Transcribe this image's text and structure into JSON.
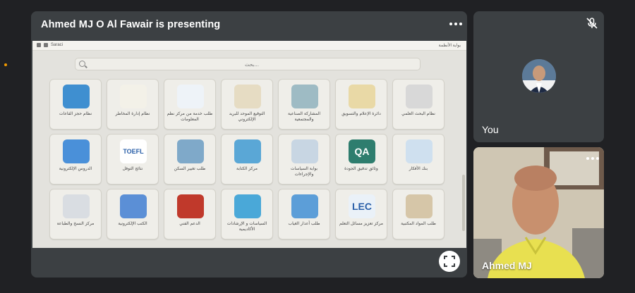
{
  "presentation": {
    "title": "Ahmed MJ O Al Fawair is presenting",
    "more_icon": "more-vert-icon",
    "fullscreen_icon": "fullscreen-icon"
  },
  "portal": {
    "topbar_left": "Saraci",
    "topbar_right": "بوابة الأنظمة",
    "search_placeholder": "بحث...",
    "tiles": [
      {
        "label": "نظام حجز القاعات",
        "icon": "calendar-icon",
        "color": "#3f8fd0"
      },
      {
        "label": "نظام إدارة المخاطر",
        "icon": "leaf-icon",
        "color": "#f3f1e8"
      },
      {
        "label": "طلب خدمة من مركز نظم المعلومات",
        "icon": "document-icon",
        "color": "#eef3f8"
      },
      {
        "label": "التوقيع الموحد للبريد الإلكتروني",
        "icon": "signature-icon",
        "color": "#e6dcc3"
      },
      {
        "label": "المشاركة الصناعية والمجتمعية",
        "icon": "factory-icon",
        "color": "#9ebbc4"
      },
      {
        "label": "دائرة الإعلام والتسويق",
        "icon": "media-icon",
        "color": "#e9d9a6"
      },
      {
        "label": "نظام البحث العلمي",
        "icon": "research-icon",
        "color": "#d8d8d8"
      },
      {
        "label": "الدروس الإلكترونية",
        "icon": "clapperboard-icon",
        "color": "#4a90d9"
      },
      {
        "label": "نتائج التوفل",
        "icon": "toefl-icon",
        "color": "#ffffff",
        "text": "TOEFL"
      },
      {
        "label": "طلب تغيير السكن",
        "icon": "building-icon",
        "color": "#7fa9c9"
      },
      {
        "label": "مركز الكتابة",
        "icon": "pen-icon",
        "color": "#5aa7d6"
      },
      {
        "label": "بوابة السياسات والإجراءات",
        "icon": "books-icon",
        "color": "#c8d6e3"
      },
      {
        "label": "وثائق تدقيق الجودة",
        "icon": "qa-icon",
        "color": "#2e7d6e",
        "text": "QA"
      },
      {
        "label": "بنك الأفكار",
        "icon": "ideas-icon",
        "color": "#cfe0ef"
      },
      {
        "label": "مركز النسخ والطباعة",
        "icon": "printer-icon",
        "color": "#d9dde2"
      },
      {
        "label": "الكتب الإلكترونية",
        "icon": "ebook-icon",
        "color": "#5b8fd6"
      },
      {
        "label": "الدعم الفني",
        "icon": "keyboard-icon",
        "color": "#c0392b"
      },
      {
        "label": "السياسات و الإرشادات الأكاديمية",
        "icon": "guide-icon",
        "color": "#4aa8d8"
      },
      {
        "label": "طلب أعذار الغياب",
        "icon": "form-icon",
        "color": "#5c9ed8"
      },
      {
        "label": "مركز تعزيز مسائل التعلم",
        "icon": "lec-icon",
        "color": "#eaf1f8",
        "text": "LEC"
      },
      {
        "label": "طلب المواد المكتبية",
        "icon": "bookshelf-icon",
        "color": "#d6c6a8"
      }
    ]
  },
  "participants": {
    "you": {
      "name": "You",
      "mic_icon": "mic-off-icon"
    },
    "presenter": {
      "name": "Ahmed MJ"
    }
  },
  "colors": {
    "background": "#202124",
    "tile": "#3c4043",
    "indicator": "#f29900"
  }
}
